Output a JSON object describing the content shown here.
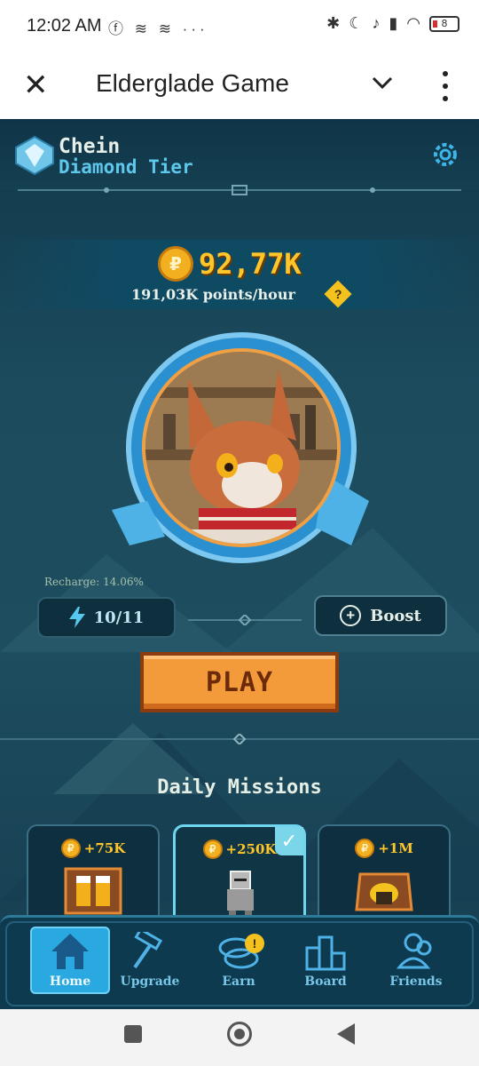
{
  "status_bar": {
    "time": "12:02 AM",
    "left_icons": "ⓕ ≋ ≋ ···",
    "battery": "8"
  },
  "app_bar": {
    "title": "Elderglade Game"
  },
  "player": {
    "name": "Chein",
    "tier": "Diamond Tier"
  },
  "balance": {
    "value": "92,77K",
    "rate": "191,03K points/hour",
    "help": "?"
  },
  "energy": {
    "recharge": "Recharge: 14.06%",
    "value": "10/11",
    "boost_label": "Boost"
  },
  "play": {
    "label": "PLAY"
  },
  "missions": {
    "title": "Daily Missions",
    "items": [
      {
        "reward": "+75K",
        "completed": false
      },
      {
        "reward": "+250K",
        "completed": true
      },
      {
        "reward": "+1M",
        "completed": false
      }
    ]
  },
  "bottom_nav": {
    "items": [
      {
        "label": "Home",
        "icon": "home-icon",
        "active": true
      },
      {
        "label": "Upgrade",
        "icon": "hammer-icon",
        "active": false
      },
      {
        "label": "Earn",
        "icon": "coins-icon",
        "active": false,
        "badge": "!"
      },
      {
        "label": "Board",
        "icon": "podium-icon",
        "active": false
      },
      {
        "label": "Friends",
        "icon": "friends-icon",
        "active": false
      }
    ]
  },
  "colors": {
    "accent_gold": "#ffc62b",
    "play_orange": "#f39a3a",
    "tier_blue": "#5ec8ec",
    "background": "#1c4b5e"
  }
}
